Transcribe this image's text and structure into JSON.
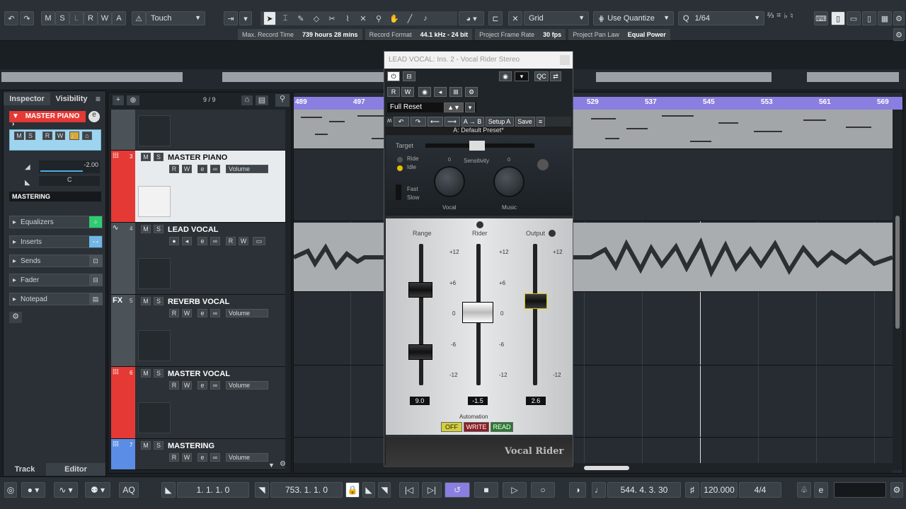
{
  "toolbar": {
    "msr": [
      "M",
      "S",
      "L",
      "R",
      "W",
      "A"
    ],
    "automation_mode": "Touch",
    "snap_type": "Grid",
    "quantize_mode": "Use Quantize",
    "quantize_value": "1/64"
  },
  "infobar": [
    {
      "label": "Max. Record Time",
      "value": "739 hours 28 mins"
    },
    {
      "label": "Record Format",
      "value": "44.1 kHz - 24 bit"
    },
    {
      "label": "Project Frame Rate",
      "value": "30 fps"
    },
    {
      "label": "Project Pan Law",
      "value": "Equal Power"
    }
  ],
  "inspector": {
    "tab_inspector": "Inspector",
    "tab_visibility": "Visibility",
    "track_name": "MASTER PIANO",
    "volume": "-2.00",
    "pan": "C",
    "output": "MASTERING",
    "sections": [
      "Equalizers",
      "Inserts",
      "Sends",
      "Fader",
      "Notepad"
    ],
    "bottom_tab_track": "Track",
    "bottom_tab_editor": "Editor",
    "msrw": [
      "M",
      "S",
      "R",
      "W"
    ]
  },
  "tracklist": {
    "count": "9 / 9",
    "tracks": [
      {
        "num": "3",
        "name": "MASTER PIANO",
        "automation": "Volume",
        "color": "#e53935"
      },
      {
        "num": "4",
        "name": "LEAD VOCAL",
        "automation": "",
        "color": "#4b5258"
      },
      {
        "num": "5",
        "name": "REVERB VOCAL",
        "automation": "Volume",
        "color": "#4b5258",
        "prefix": "FX"
      },
      {
        "num": "6",
        "name": "MASTER VOCAL",
        "automation": "Volume",
        "color": "#e53935"
      },
      {
        "num": "7",
        "name": "MASTERING",
        "automation": "Volume",
        "color": "#5b8de6"
      }
    ]
  },
  "ruler": {
    "bars": [
      "489",
      "497",
      "529",
      "537",
      "545",
      "553",
      "561",
      "569"
    ]
  },
  "plugin": {
    "title": "LEAD VOCAL: Ins. 2 - Vocal Rider Stereo",
    "preset_field": "Full Reset",
    "preset_name": "A: Default Preset*",
    "buttons": {
      "r": "R",
      "w": "W",
      "qc": "QC",
      "ab": "A → B",
      "setup": "Setup A",
      "save": "Save"
    },
    "labels": {
      "target": "Target",
      "ride": "Ride",
      "idle": "Idle",
      "sensitivity": "Sensitivity",
      "fast": "Fast",
      "slow": "Slow",
      "vocal": "Vocal",
      "music": "Music",
      "range": "Range",
      "rider": "Rider",
      "output": "Output",
      "automation": "Automation",
      "brand": "Vocal Rider",
      "knob_zero": "0"
    },
    "scale": [
      "+12",
      "+6",
      "0",
      "-6",
      "-12"
    ],
    "values": {
      "range": "9.0",
      "rider": "-1.5",
      "output": "2.6"
    },
    "auto_modes": [
      "OFF",
      "WRITE",
      "READ"
    ]
  },
  "transport": {
    "aq": "AQ",
    "left_locator": "1. 1. 1.   0",
    "right_locator": "753. 1. 1.   0",
    "position": "544. 4. 3. 30",
    "tempo": "120.000",
    "signature": "4/4"
  },
  "colors": {
    "accent": "#8a7ee0",
    "red": "#e53935",
    "blue": "#5b8de6",
    "green": "#2ecc71"
  }
}
